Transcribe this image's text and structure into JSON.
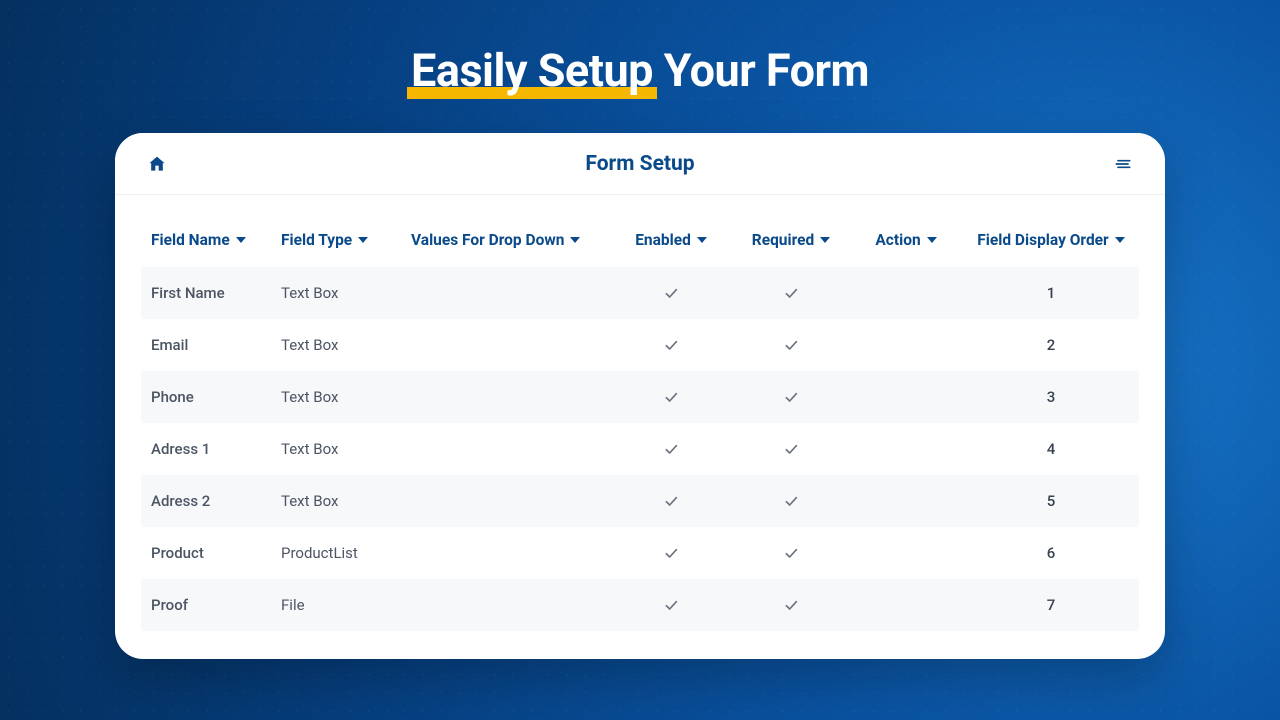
{
  "hero": {
    "accent": "Easily Setup",
    "rest": " Your Form"
  },
  "header": {
    "title": "Form Setup"
  },
  "table": {
    "columns": {
      "fieldName": "Field Name",
      "fieldType": "Field Type",
      "values": "Values For Drop Down",
      "enabled": "Enabled",
      "required": "Required",
      "action": "Action",
      "order": "Field Display Order"
    },
    "rows": [
      {
        "name": "First Name",
        "type": "Text Box",
        "enabled": true,
        "required": true,
        "order": "1"
      },
      {
        "name": "Email",
        "type": "Text Box",
        "enabled": true,
        "required": true,
        "order": "2"
      },
      {
        "name": "Phone",
        "type": "Text Box",
        "enabled": true,
        "required": true,
        "order": "3"
      },
      {
        "name": "Adress 1",
        "type": "Text Box",
        "enabled": true,
        "required": true,
        "order": "4"
      },
      {
        "name": "Adress 2",
        "type": "Text Box",
        "enabled": true,
        "required": true,
        "order": "5"
      },
      {
        "name": "Product",
        "type": "ProductList",
        "enabled": true,
        "required": true,
        "order": "6"
      },
      {
        "name": "Proof",
        "type": "File",
        "enabled": true,
        "required": true,
        "order": "7"
      }
    ]
  }
}
